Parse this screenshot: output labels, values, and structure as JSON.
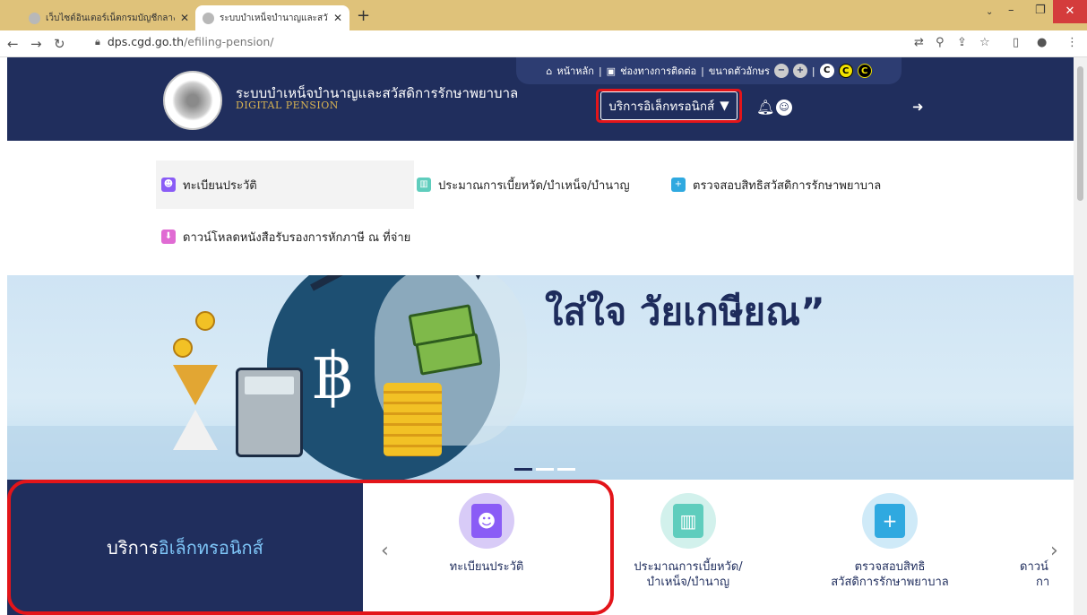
{
  "browser": {
    "tabs": [
      {
        "title": "เว็บไซต์อินเตอร์เน็ตกรมบัญชีกลาง",
        "active": false
      },
      {
        "title": "ระบบบำเหน็จบำนาญและสวัสดิการรักษ",
        "active": true
      }
    ],
    "url_host": "dps.cgd.go.th",
    "url_path": "/efiling-pension/"
  },
  "header": {
    "title": "ระบบบำเหน็จบำนาญและสวัสดิการรักษาพยาบาล",
    "subtitle": "DIGITAL PENSION",
    "toplinks": {
      "home": "หน้าหลัก",
      "contact": "ช่องทางการติดต่อ",
      "font_size": "ขนาดตัวอักษร",
      "contrast_label": "C"
    },
    "eservice_dropdown": "บริการอิเล็กทรอนิกส์"
  },
  "menu": {
    "items": [
      {
        "label": "ทะเบียนประวัติ",
        "color": "#8a5cf6"
      },
      {
        "label": "ประมาณการเบี้ยหวัด/บำเหน็จ/บำนาญ",
        "color": "#5fcdbd"
      },
      {
        "label": "ตรวจสอบสิทธิสวัสดิการรักษาพยาบาล",
        "color": "#2fa9e0"
      },
      {
        "label": "ดาวน์โหลดหนังสือรับรองการหักภาษี ณ ที่จ่าย",
        "color": "#e06bd3"
      }
    ]
  },
  "banner": {
    "slogan": "ใส่ใจ วัยเกษียณ”"
  },
  "eservices": {
    "label_main": "บริการ",
    "label_accent": "อิเล็กทรอนิกส์",
    "cards": [
      {
        "line1": "ทะเบียนประวัติ",
        "line2": ""
      },
      {
        "line1": "ประมาณการเบี้ยหวัด/",
        "line2": "บำเหน็จ/บำนาญ"
      },
      {
        "line1": "ตรวจสอบสิทธิ",
        "line2": "สวัสดิการรักษาพยาบาล"
      },
      {
        "line1": "ดาวน์",
        "line2": "กา"
      }
    ]
  }
}
